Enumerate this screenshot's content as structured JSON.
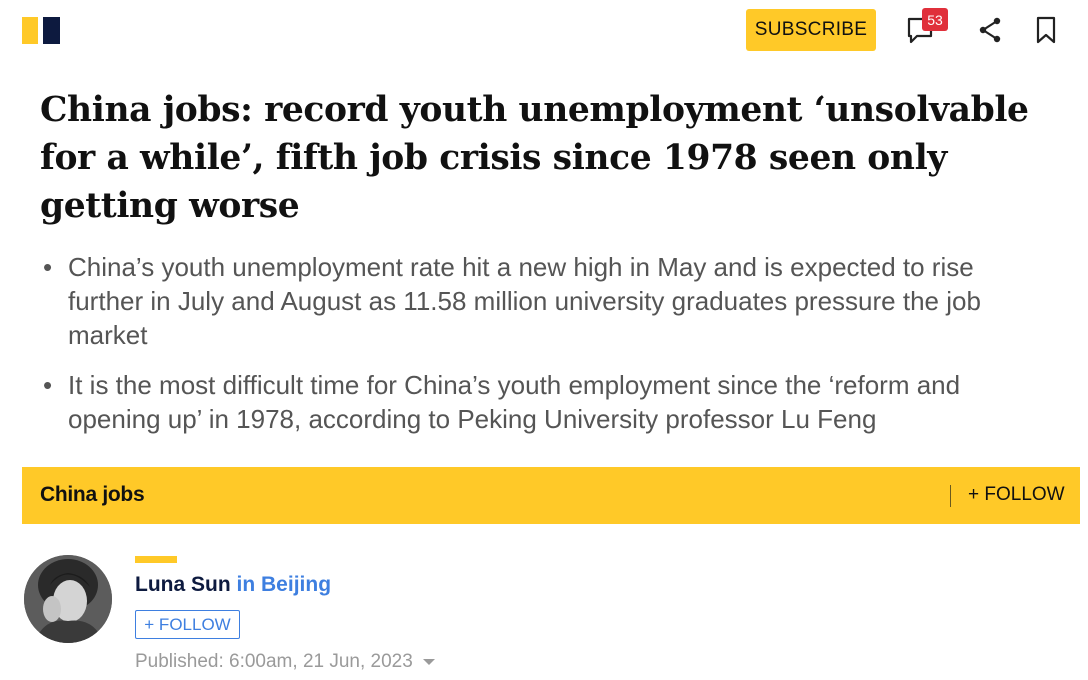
{
  "header": {
    "subscribe_label": "SUBSCRIBE",
    "comment_count": "53",
    "accent_color": "#ffc928",
    "brand_navy": "#0d1a3f",
    "badge_color": "#e0303b"
  },
  "article": {
    "headline": "China jobs: record youth unemployment ‘unsolvable for a while’, fifth job crisis since 1978 seen only getting worse",
    "summary": [
      "China’s youth unemployment rate hit a new high in May and is expected to rise further in July and August as 11.58 million university graduates pressure the job market",
      "It is the most difficult time for China’s youth employment since the ‘reform and opening up’ in 1978, according to Peking University professor Lu Feng"
    ]
  },
  "topic": {
    "name": "China jobs",
    "follow_label": "+ FOLLOW"
  },
  "author": {
    "name": "Luna Sun",
    "location": "in Beijing",
    "follow_label": "+ FOLLOW",
    "published": "Published: 6:00am, 21 Jun, 2023"
  },
  "icons": {
    "logo": "scmp-logo",
    "comments": "comment-icon",
    "share": "share-icon",
    "bookmark": "bookmark-icon",
    "expand": "caret-down-icon"
  }
}
